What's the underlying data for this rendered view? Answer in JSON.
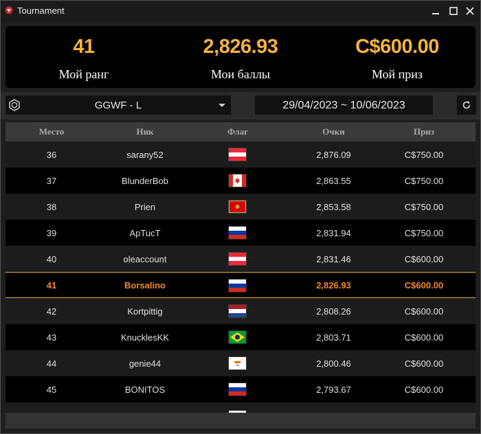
{
  "window": {
    "title": "Tournament",
    "controls": [
      "minimize",
      "maximize",
      "close"
    ]
  },
  "summary": {
    "rank_value": "41",
    "rank_label": "Мой ранг",
    "points_value": "2,826.93",
    "points_label": "Мои баллы",
    "prize_value": "C$600.00",
    "prize_label": "Мой приз"
  },
  "filters": {
    "league": "GGWF - L",
    "date_range": "29/04/2023 ~ 10/06/2023"
  },
  "table": {
    "headers": {
      "place": "Место",
      "nick": "Ник",
      "flag": "Флаг",
      "points": "Очки",
      "prize": "Приз"
    },
    "rows": [
      {
        "place": "36",
        "nick": "sarany52",
        "flag": "austria",
        "points": "2,876.09",
        "prize": "C$750.00"
      },
      {
        "place": "37",
        "nick": "BlunderBob",
        "flag": "canada",
        "points": "2,863.55",
        "prize": "C$750.00"
      },
      {
        "place": "38",
        "nick": "Prien",
        "flag": "montenegro",
        "points": "2,853.58",
        "prize": "C$750.00"
      },
      {
        "place": "39",
        "nick": "ApTucT",
        "flag": "russia",
        "points": "2,831.94",
        "prize": "C$750.00"
      },
      {
        "place": "40",
        "nick": "oleaccount",
        "flag": "austria",
        "points": "2,831.46",
        "prize": "C$600.00"
      },
      {
        "place": "41",
        "nick": "Borsalino",
        "flag": "russia",
        "points": "2,826.93",
        "prize": "C$600.00",
        "highlighted": true
      },
      {
        "place": "42",
        "nick": "Kortpittig",
        "flag": "netherlands",
        "points": "2,808.26",
        "prize": "C$600.00"
      },
      {
        "place": "43",
        "nick": "KnucklesKK",
        "flag": "brazil",
        "points": "2,803.71",
        "prize": "C$600.00"
      },
      {
        "place": "44",
        "nick": "genie44",
        "flag": "cyprus",
        "points": "2,800.46",
        "prize": "C$600.00"
      },
      {
        "place": "45",
        "nick": "BONITOS",
        "flag": "russia",
        "points": "2,793.67",
        "prize": "C$600.00"
      }
    ]
  },
  "colors": {
    "accent": "#f5b340",
    "highlight_text": "#f08a2a",
    "highlight_border": "#e8a74a"
  }
}
